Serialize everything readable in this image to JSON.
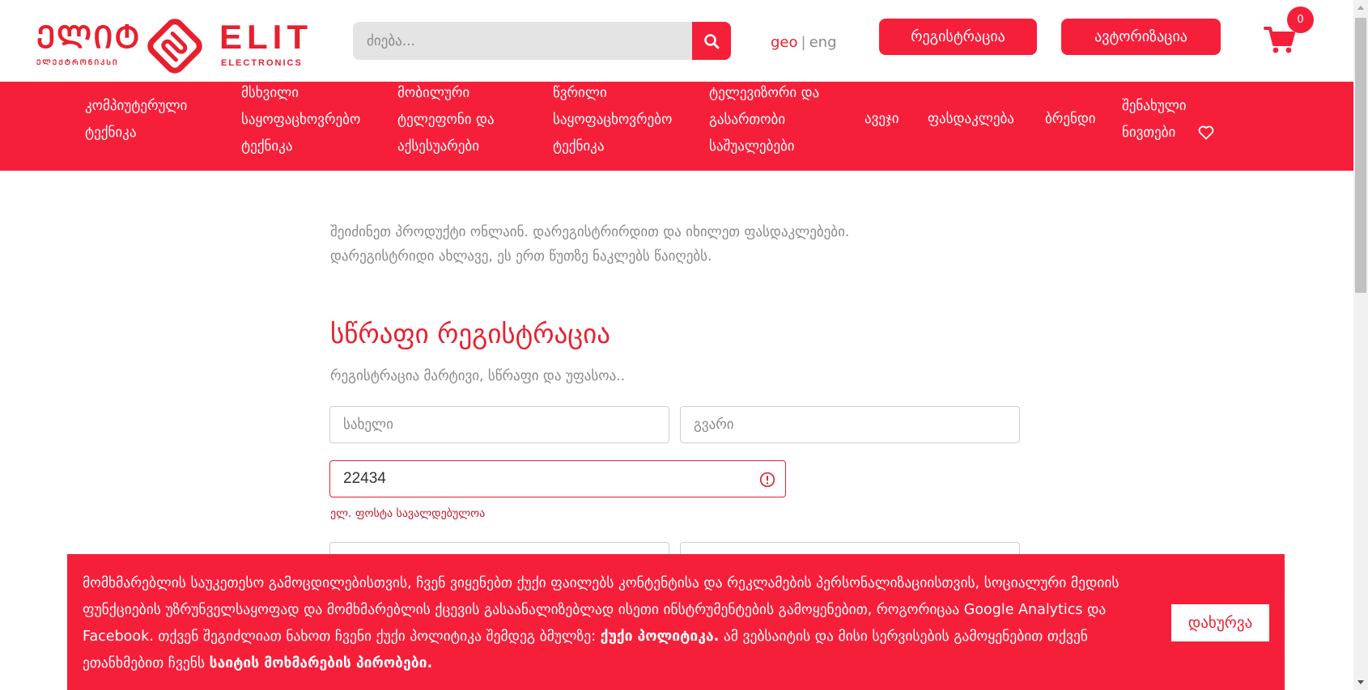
{
  "header": {
    "logo_ka": "ᲔᲚᲘᲢ",
    "logo_ka_sub": "ᲔᲚᲔᲥᲢᲠᲝᲜᲘᲙᲡᲘ",
    "logo_en": "ELIT",
    "logo_en_sub": "ELECTRONICS",
    "search_placeholder": "ძიება...",
    "lang_geo": "geo",
    "lang_sep": "|",
    "lang_eng": "eng",
    "register_label": "რეგისტრაცია",
    "login_label": "ავტორიზაცია",
    "cart_count": "0"
  },
  "nav": {
    "items": [
      {
        "label": "კომპიუტერული\nტექნიკა"
      },
      {
        "label": "მსხვილი\nსაყოფაცხოვრებო\nტექნიკა"
      },
      {
        "label": "მობილური\nტელეფონი და\nაქსესუარები"
      },
      {
        "label": "წვრილი\nსაყოფაცხოვრებო\nტექნიკა"
      },
      {
        "label": "ტელევიზორი და\nგასართობი\nსაშუალებები"
      },
      {
        "label": "ავეჯი"
      },
      {
        "label": "ფასდაკლება"
      },
      {
        "label": "ბრენდი"
      },
      {
        "label": "შენახული\nნივთები"
      }
    ]
  },
  "main": {
    "intro_line1": "შეიძინეთ პროდუქტი ონლაინ. დარეგისტრირდით და იხილეთ ფასდაკლებები.",
    "intro_line2": "დარეგისტრიდი ახლავე, ეს ერთ წუთზე ნაკლებს წაიღებს.",
    "title": "სწრაფი რეგისტრაცია",
    "subtitle": "რეგისტრაცია მარტივი, სწრაფი და უფასოა..",
    "first_name_placeholder": "სახელი",
    "last_name_placeholder": "გვარი",
    "email_value": "22434",
    "email_error": "ელ. ფოსტა სავალდებულოა"
  },
  "cookie": {
    "text_1": "მომხმარებლის საუკეთესო გამოცდილებისთვის, ჩვენ ვიყენებთ ქუქი ფაილებს კონტენტისა და რეკლამების პერსონალიზაციისთვის, სოციალური მედიის ფუნქციების უზრუნველსაყოფად და მომხმარებლის ქცევის გასაანალიზებლად ისეთი ინსტრუმენტების გამოყენებით, როგორიცაა Google Analytics და Facebook. თქვენ შეგიძლიათ ნახოთ ჩვენი ქუქი პოლიტიკა შემდეგ ბმულზე: ",
    "link_1": "ქუქი პოლიტიკა.",
    "text_2": " ამ ვებსაიტის და მისი სერვისების გამოყენებით თქვენ ეთანხმებით ჩვენს ",
    "link_2": "საიტის მოხმარების პირობები.",
    "close_label": "დახურვა"
  },
  "colors": {
    "brand_red": "#f61f3a",
    "logo_red": "#e8202e",
    "text_gray": "#8a8a8a"
  }
}
